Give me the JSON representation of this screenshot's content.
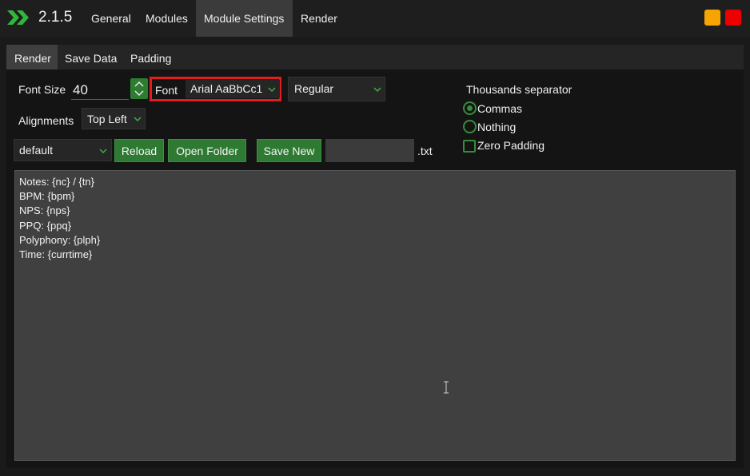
{
  "app": {
    "version": "2.1.5",
    "accent_color": "#2f7a32",
    "logo_icon": "double-chevron-right-icon"
  },
  "top_tabs": [
    {
      "label": "General",
      "active": false
    },
    {
      "label": "Modules",
      "active": false
    },
    {
      "label": "Module Settings",
      "active": true
    },
    {
      "label": "Render",
      "active": false
    }
  ],
  "window_controls": {
    "minimize_color": "#f5a400",
    "close_color": "#ee0000"
  },
  "sub_tabs": [
    {
      "label": "Render",
      "active": true
    },
    {
      "label": "Save Data",
      "active": false
    },
    {
      "label": "Padding",
      "active": false
    }
  ],
  "font_size": {
    "label": "Font Size",
    "value": "40"
  },
  "font": {
    "label": "Font",
    "value": "Arial AaBbCc1",
    "highlight_color": "#e41c1c"
  },
  "font_style": {
    "value": "Regular"
  },
  "alignments": {
    "label": "Alignments",
    "value": "Top Left"
  },
  "template": {
    "selected": "default",
    "reload_label": "Reload",
    "open_folder_label": "Open Folder",
    "save_new_label": "Save New",
    "filename_value": "",
    "extension": ".txt"
  },
  "thousands_separator": {
    "title": "Thousands separator",
    "options": [
      {
        "label": "Commas",
        "checked": true
      },
      {
        "label": "Nothing",
        "checked": false
      }
    ],
    "zero_padding": {
      "label": "Zero Padding",
      "checked": false
    }
  },
  "editor": {
    "lines": [
      "Notes: {nc} / {tn}",
      "BPM: {bpm}",
      "NPS: {nps}",
      "PPQ: {ppq}",
      "Polyphony: {plph}",
      "Time: {currtime}"
    ],
    "cursor_icon": "text-cursor-icon"
  }
}
